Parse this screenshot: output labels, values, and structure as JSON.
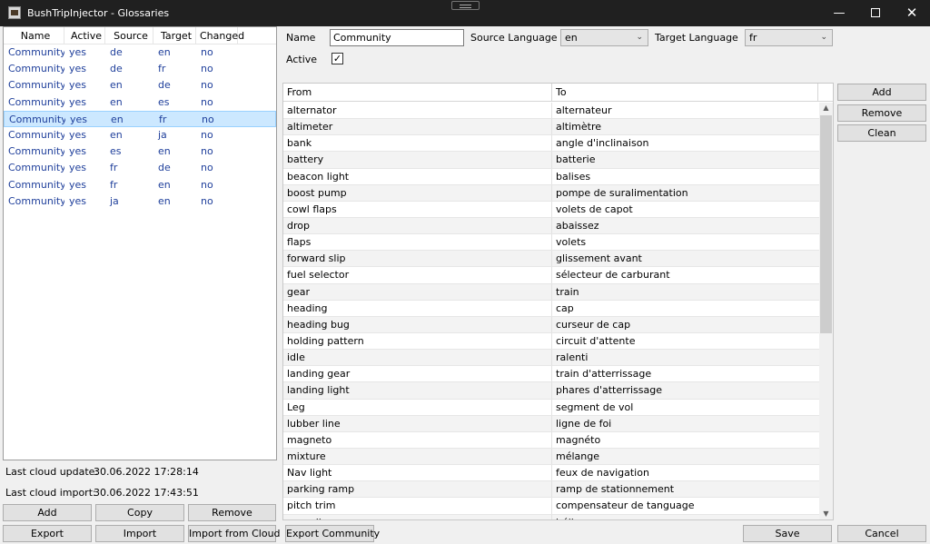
{
  "window": {
    "title": "BushTripInjector - Glossaries",
    "minimize_glyph": "—",
    "close_glyph": "✕"
  },
  "glossary_list": {
    "columns": [
      "Name",
      "Active",
      "Source",
      "Target",
      "Changed"
    ],
    "rows": [
      {
        "name": "Community",
        "active": "yes",
        "source": "de",
        "target": "en",
        "changed": "no"
      },
      {
        "name": "Community",
        "active": "yes",
        "source": "de",
        "target": "fr",
        "changed": "no"
      },
      {
        "name": "Community",
        "active": "yes",
        "source": "en",
        "target": "de",
        "changed": "no"
      },
      {
        "name": "Community",
        "active": "yes",
        "source": "en",
        "target": "es",
        "changed": "no"
      },
      {
        "name": "Community",
        "active": "yes",
        "source": "en",
        "target": "fr",
        "changed": "no"
      },
      {
        "name": "Community",
        "active": "yes",
        "source": "en",
        "target": "ja",
        "changed": "no"
      },
      {
        "name": "Community",
        "active": "yes",
        "source": "es",
        "target": "en",
        "changed": "no"
      },
      {
        "name": "Community",
        "active": "yes",
        "source": "fr",
        "target": "de",
        "changed": "no"
      },
      {
        "name": "Community",
        "active": "yes",
        "source": "fr",
        "target": "en",
        "changed": "no"
      },
      {
        "name": "Community",
        "active": "yes",
        "source": "ja",
        "target": "en",
        "changed": "no"
      }
    ],
    "selected_index": 4
  },
  "cloud": {
    "last_update_label": "Last cloud update:",
    "last_update_value": "30.06.2022 17:28:14",
    "last_import_label": "Last cloud import:",
    "last_import_value": "30.06.2022 17:43:51"
  },
  "left_buttons": {
    "add": "Add",
    "copy": "Copy",
    "remove": "Remove",
    "export": "Export",
    "import": "Import",
    "import_cloud": "Import from Cloud"
  },
  "details": {
    "name_label": "Name",
    "name_value": "Community",
    "source_lang_label": "Source Language",
    "source_lang_value": "en",
    "target_lang_label": "Target Language",
    "target_lang_value": "fr",
    "active_label": "Active",
    "active_checked": true,
    "check_glyph": "✓",
    "chevron_glyph": "⌄"
  },
  "terms": {
    "columns": [
      "From",
      "To"
    ],
    "rows": [
      {
        "from": "alternator",
        "to": "alternateur"
      },
      {
        "from": "altimeter",
        "to": "altimètre"
      },
      {
        "from": "bank",
        "to": "angle d'inclinaison"
      },
      {
        "from": "battery",
        "to": "batterie"
      },
      {
        "from": "beacon light",
        "to": "balises"
      },
      {
        "from": "boost pump",
        "to": "pompe de suralimentation"
      },
      {
        "from": "cowl flaps",
        "to": "volets de capot"
      },
      {
        "from": "drop",
        "to": "abaissez"
      },
      {
        "from": "flaps",
        "to": "volets"
      },
      {
        "from": "forward slip",
        "to": "glissement avant"
      },
      {
        "from": "fuel selector",
        "to": "sélecteur de carburant"
      },
      {
        "from": "gear",
        "to": "train"
      },
      {
        "from": "heading",
        "to": "cap"
      },
      {
        "from": "heading bug",
        "to": "curseur de cap"
      },
      {
        "from": "holding pattern",
        "to": "circuit d'attente"
      },
      {
        "from": "idle",
        "to": "ralenti"
      },
      {
        "from": "landing gear",
        "to": "train d'atterrissage"
      },
      {
        "from": "landing light",
        "to": "phares d'atterrissage"
      },
      {
        "from": "Leg",
        "to": "segment de vol"
      },
      {
        "from": "lubber line",
        "to": "ligne de foi"
      },
      {
        "from": "magneto",
        "to": "magnéto"
      },
      {
        "from": "mixture",
        "to": "mélange"
      },
      {
        "from": "Nav light",
        "to": "feux de navigation"
      },
      {
        "from": "parking ramp",
        "to": "ramp de stationnement"
      },
      {
        "from": "pitch trim",
        "to": "compensateur de tanguage"
      },
      {
        "from": "propeller",
        "to": "hélice"
      }
    ],
    "scroll_up_glyph": "▲",
    "scroll_down_glyph": "▼"
  },
  "right_buttons": {
    "add": "Add",
    "remove": "Remove",
    "clean": "Clean",
    "export_community": "Export Community",
    "save": "Save",
    "cancel": "Cancel"
  }
}
